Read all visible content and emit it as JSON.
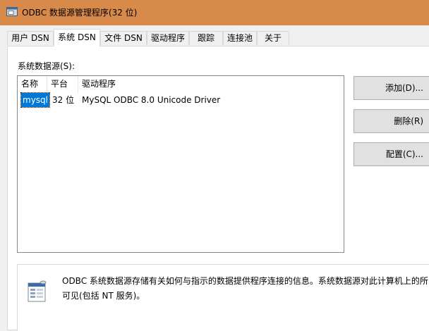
{
  "window": {
    "title": "ODBC 数据源管理程序(32 位)"
  },
  "tabs": [
    {
      "label": "用户 DSN"
    },
    {
      "label": "系统 DSN"
    },
    {
      "label": "文件 DSN"
    },
    {
      "label": "驱动程序"
    },
    {
      "label": "跟踪"
    },
    {
      "label": "连接池"
    },
    {
      "label": "关于"
    }
  ],
  "main": {
    "section_label": "系统数据源(S):",
    "columns": [
      "名称",
      "平台",
      "驱动程序"
    ],
    "rows": [
      {
        "name": "mysql",
        "platform": "32 位",
        "driver": "MySQL ODBC 8.0 Unicode Driver"
      }
    ],
    "buttons": {
      "add": "添加(D)...",
      "remove": "删除(R)",
      "configure": "配置(C)..."
    },
    "info_line1": "ODBC 系统数据源存储有关如何与指示的数据提供程序连接的信息。系统数据源对此计算机上的所",
    "info_line2": "可见(包括 NT 服务)。"
  },
  "colors": {
    "titlebar": "#d88a4b",
    "selection": "#0078d7"
  }
}
